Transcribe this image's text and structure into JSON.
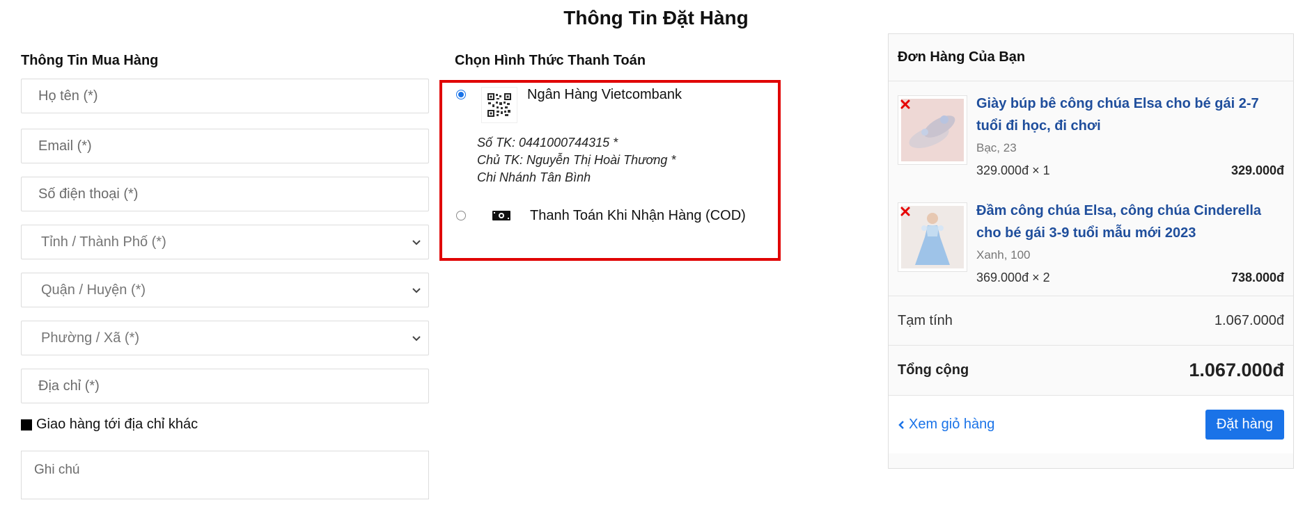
{
  "page": {
    "title": "Thông Tin Đặt Hàng"
  },
  "buyer": {
    "section_title": "Thông Tin Mua Hàng",
    "fields": {
      "name_placeholder": "Họ tên (*)",
      "email_placeholder": "Email (*)",
      "phone_placeholder": "Số điện thoại (*)",
      "address_placeholder": "Địa chỉ (*)"
    },
    "selects": {
      "province": "Tỉnh / Thành Phố (*)",
      "district": "Quận / Huyện (*)",
      "ward": "Phường / Xã (*)"
    },
    "ship_other_label": "Giao hàng tới địa chỉ khác",
    "note_placeholder": "Ghi chú"
  },
  "payment": {
    "section_title": "Chọn Hình Thức Thanh Toán",
    "highlight_color": "#e00000",
    "options": [
      {
        "label": "Ngân Hàng Vietcombank",
        "selected": true,
        "details": [
          "Số TK: 0441000744315 *",
          "Chủ TK: Nguyễn Thị Hoài Thương *",
          "Chi Nhánh Tân Bình"
        ]
      },
      {
        "label": "Thanh Toán Khi Nhận Hàng (COD)",
        "selected": false
      }
    ]
  },
  "order": {
    "header": "Đơn Hàng Của Bạn",
    "items": [
      {
        "name": "Giày búp bê công chúa Elsa cho bé gái 2-7 tuổi đi học, đi chơi",
        "variant": "Bạc, 23",
        "unit_qty": "329.000đ × 1",
        "total": "329.000đ"
      },
      {
        "name": "Đầm công chúa Elsa, công chúa Cinderella cho bé gái 3-9 tuổi mẫu mới 2023",
        "variant": "Xanh, 100",
        "unit_qty": "369.000đ × 2",
        "total": "738.000đ"
      }
    ],
    "subtotal_label": "Tạm tính",
    "subtotal_value": "1.067.000đ",
    "total_label": "Tổng cộng",
    "total_value": "1.067.000đ",
    "back_link": "Xem giỏ hàng",
    "order_button": "Đặt hàng",
    "accent_color": "#1a73e8"
  }
}
